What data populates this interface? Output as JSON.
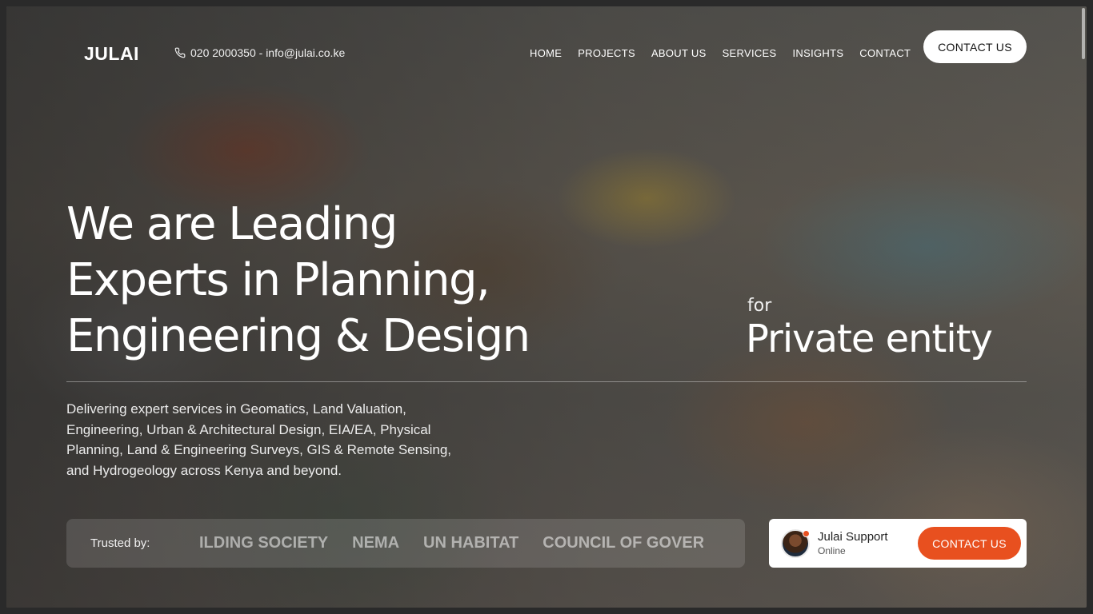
{
  "brand": {
    "logo": "JULAI"
  },
  "header": {
    "contact_text": "020 2000350 - info@julai.co.ke",
    "nav": [
      "HOME",
      "PROJECTS",
      "ABOUT US",
      "SERVICES",
      "INSIGHTS",
      "CONTACT"
    ],
    "cta": "CONTACT US"
  },
  "hero": {
    "headline": [
      "We are Leading",
      "Experts in Planning,",
      "Engineering & Design"
    ],
    "for_label": "for",
    "entity": "Private entity",
    "description": "Delivering expert services in Geomatics, Land Valuation, Engineering, Urban & Architectural Design, EIA/EA, Physical Planning, Land & Engineering Surveys, GIS & Remote Sensing, and Hydrogeology across Kenya and beyond."
  },
  "trusted": {
    "label": "Trusted by:",
    "logos": [
      "ILDING SOCIETY",
      "NEMA",
      "UN HABITAT",
      "COUNCIL OF GOVER"
    ]
  },
  "support": {
    "name": "Julai Support",
    "status": "Online",
    "cta": "CONTACT US"
  },
  "colors": {
    "accent": "#e8501f",
    "text": "#ffffff"
  },
  "icons": {
    "phone": "phone-icon"
  }
}
